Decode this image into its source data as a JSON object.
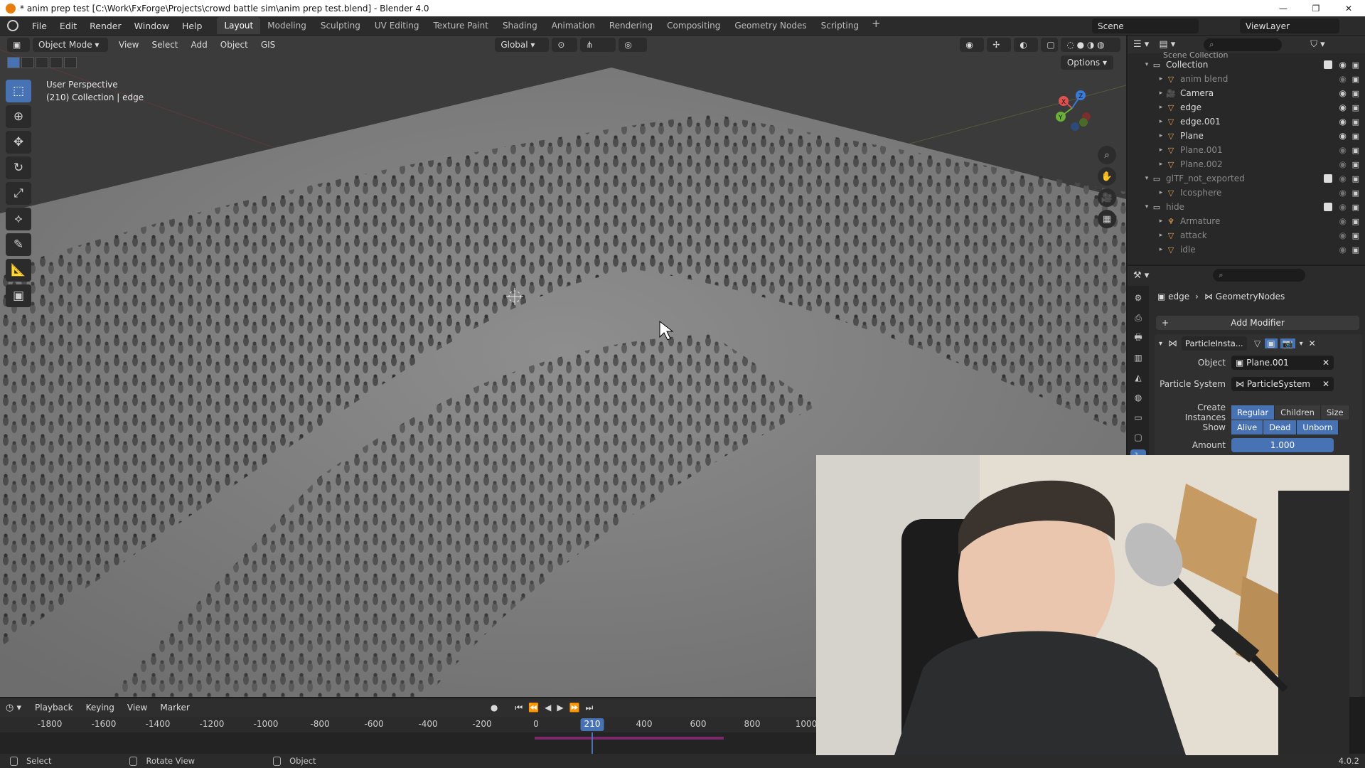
{
  "window": {
    "title": "* anim prep test [C:\\Work\\FxForge\\Projects\\crowd battle sim\\anim prep test.blend] - Blender 4.0",
    "controls": [
      "—",
      "❐",
      "✕"
    ]
  },
  "menu": {
    "items": [
      "File",
      "Edit",
      "Render",
      "Window",
      "Help"
    ]
  },
  "workspaces": {
    "tabs": [
      "Layout",
      "Modeling",
      "Sculpting",
      "UV Editing",
      "Texture Paint",
      "Shading",
      "Animation",
      "Rendering",
      "Compositing",
      "Geometry Nodes",
      "Scripting"
    ],
    "active": "Layout",
    "add": "+"
  },
  "scene": {
    "name": "Scene",
    "view_layer": "ViewLayer"
  },
  "viewport": {
    "mode": "Object Mode",
    "menus": [
      "View",
      "Select",
      "Add",
      "Object",
      "GIS"
    ],
    "transform": "Global",
    "options": "Options",
    "overlay_line1": "User Perspective",
    "overlay_line2": "(210) Collection | edge",
    "gizmo_axes": {
      "x": "X",
      "y": "Y",
      "z": "Z"
    }
  },
  "outliner": {
    "top_label": "Scene Collection",
    "rows": [
      {
        "label": "Collection",
        "type": "collection",
        "indent": 1,
        "dim": false
      },
      {
        "label": "anim blend",
        "type": "mesh",
        "indent": 2,
        "dim": true
      },
      {
        "label": "Camera",
        "type": "camera",
        "indent": 2,
        "dim": false
      },
      {
        "label": "edge",
        "type": "mesh",
        "indent": 2,
        "dim": false
      },
      {
        "label": "edge.001",
        "type": "mesh",
        "indent": 2,
        "dim": false
      },
      {
        "label": "Plane",
        "type": "mesh",
        "indent": 2,
        "dim": false
      },
      {
        "label": "Plane.001",
        "type": "mesh",
        "indent": 2,
        "dim": true
      },
      {
        "label": "Plane.002",
        "type": "mesh",
        "indent": 2,
        "dim": true
      },
      {
        "label": "glTF_not_exported",
        "type": "collection",
        "indent": 1,
        "dim": true
      },
      {
        "label": "Icosphere",
        "type": "mesh",
        "indent": 2,
        "dim": true
      },
      {
        "label": "hide",
        "type": "collection",
        "indent": 1,
        "dim": true
      },
      {
        "label": "Armature",
        "type": "armature",
        "indent": 2,
        "dim": true
      },
      {
        "label": "attack",
        "type": "mesh",
        "indent": 2,
        "dim": true
      },
      {
        "label": "idle",
        "type": "mesh",
        "indent": 2,
        "dim": true
      }
    ]
  },
  "properties": {
    "breadcrumb_object": "edge",
    "breadcrumb_modifier": "GeometryNodes",
    "add_modifier": "Add Modifier",
    "modifier_name": "ParticleInsta...",
    "object_label": "Object",
    "object_value": "Plane.001",
    "particle_system_label": "Particle System",
    "particle_system_value": "ParticleSystem",
    "create_instances_label": "Create Instances",
    "create_instances_options": [
      "Regular",
      "Children",
      "Size"
    ],
    "show_label": "Show",
    "show_options": [
      "Alive",
      "Dead",
      "Unborn"
    ],
    "amount_label": "Amount",
    "amount_value": "1.000"
  },
  "timeline": {
    "menus": [
      "Playback",
      "Keying",
      "View",
      "Marker"
    ],
    "ticks": [
      "-1800",
      "-1600",
      "-1400",
      "-1200",
      "-1000",
      "-800",
      "-600",
      "-400",
      "-200",
      "0",
      "400",
      "600",
      "800",
      "1000"
    ],
    "current_frame": "210"
  },
  "statusbar": {
    "items": [
      "Select",
      "Rotate View",
      "Object"
    ],
    "version": "4.0.2"
  }
}
